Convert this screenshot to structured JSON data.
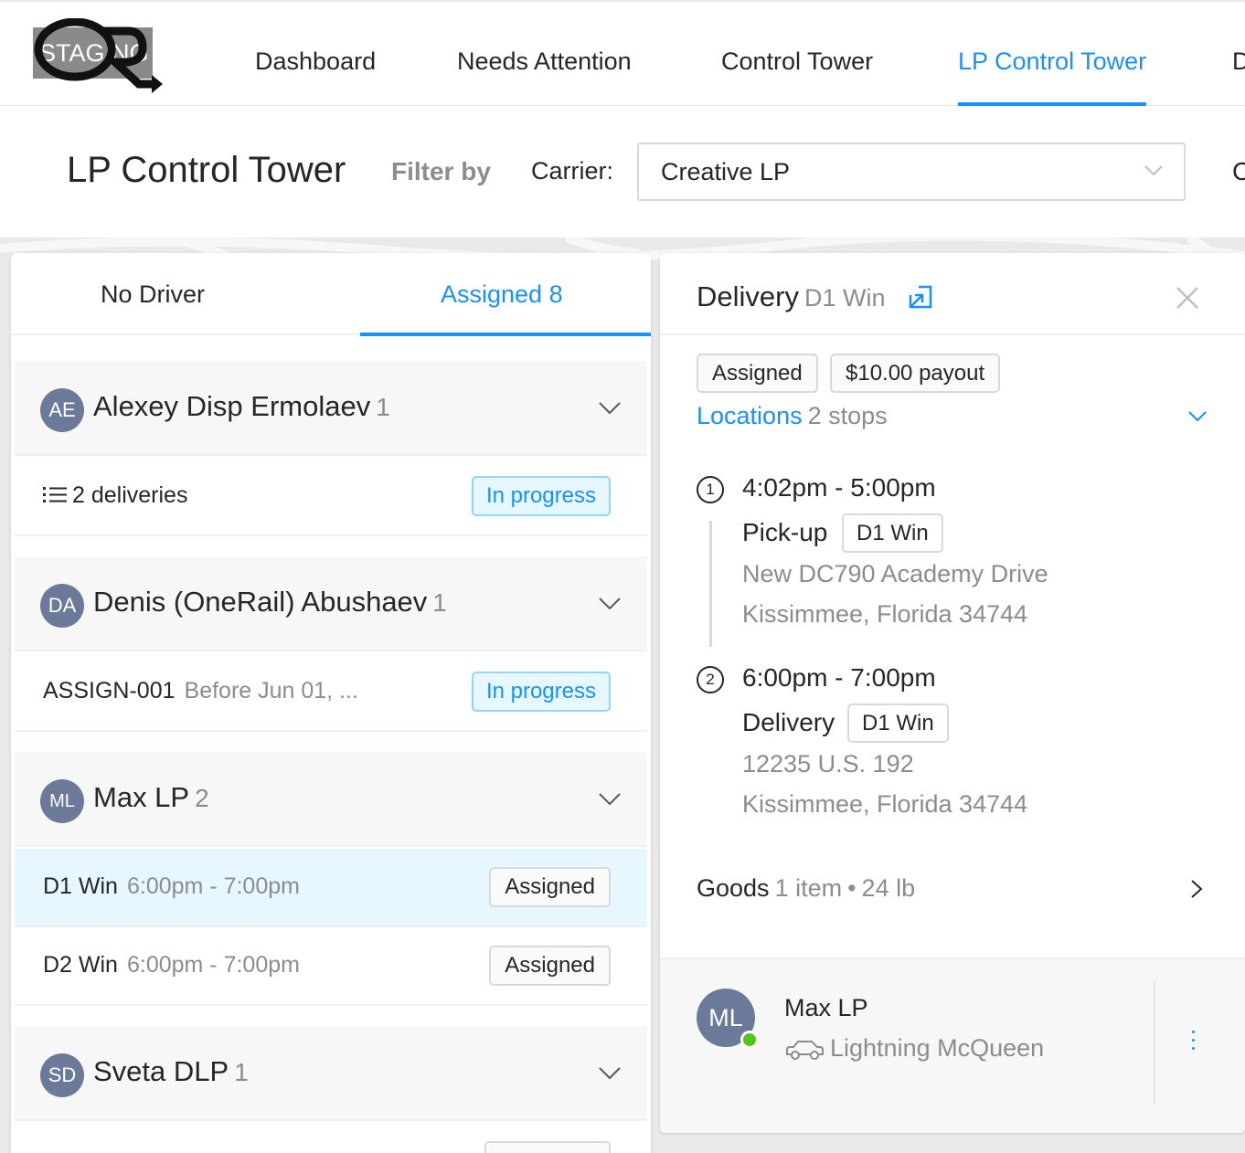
{
  "app": {
    "env_badge": "STAGING",
    "nav": [
      {
        "label": "Dashboard",
        "active": false
      },
      {
        "label": "Needs Attention",
        "active": false
      },
      {
        "label": "Control Tower",
        "active": false
      },
      {
        "label": "LP Control Tower",
        "active": true
      },
      {
        "label": "D",
        "active": false
      }
    ],
    "accent_color": "#1890ff"
  },
  "header": {
    "title": "LP Control Tower",
    "filter_by": "Filter by",
    "carrier_label": "Carrier:",
    "carrier_value": "Creative LP",
    "clipped_label": "C"
  },
  "left_panel": {
    "tabs": [
      {
        "label": "No Driver",
        "active": false
      },
      {
        "label": "Assigned 8",
        "active": true
      }
    ],
    "groups": [
      {
        "initials": "AE",
        "name": "Alexey Disp Ermolaev",
        "count": "1",
        "rows": [
          {
            "icon": "list-icon",
            "title": "2 deliveries",
            "meta": "",
            "status": "In progress",
            "status_style": "blue",
            "selected": false
          }
        ]
      },
      {
        "initials": "DA",
        "name": "Denis (OneRail) Abushaev",
        "count": "1",
        "rows": [
          {
            "title": "ASSIGN-001",
            "meta": "Before Jun 01, ...",
            "status": "In progress",
            "status_style": "blue",
            "selected": false
          }
        ]
      },
      {
        "initials": "ML",
        "name": "Max LP",
        "count": "2",
        "rows": [
          {
            "title": "D1 Win",
            "meta": "6:00pm - 7:00pm",
            "status": "Assigned",
            "status_style": "gray",
            "selected": true
          },
          {
            "title": "D2 Win",
            "meta": "6:00pm - 7:00pm",
            "status": "Assigned",
            "status_style": "gray",
            "selected": false
          }
        ]
      },
      {
        "initials": "SD",
        "name": "Sveta DLP",
        "count": "1",
        "rows": []
      }
    ]
  },
  "detail": {
    "title": "Delivery",
    "subtitle": "D1 Win",
    "tags": [
      "Assigned",
      "$10.00 payout"
    ],
    "locations_label": "Locations",
    "locations_count": "2 stops",
    "stops": [
      {
        "num": "1",
        "time": "4:02pm - 5:00pm",
        "type": "Pick-up",
        "tag": "D1 Win",
        "addr1": "New DC790 Academy Drive",
        "addr2": "Kissimmee, Florida 34744"
      },
      {
        "num": "2",
        "time": "6:00pm - 7:00pm",
        "type": "Delivery",
        "tag": "D1 Win",
        "addr1": "12235 U.S. 192",
        "addr2": "Kissimmee, Florida 34744"
      }
    ],
    "goods_label": "Goods",
    "goods_items": "1 item",
    "goods_sep": "•",
    "goods_weight": "24 lb",
    "driver": {
      "initials": "ML",
      "name": "Max LP",
      "vehicle": "Lightning McQueen",
      "online_color": "#52c41a"
    }
  }
}
